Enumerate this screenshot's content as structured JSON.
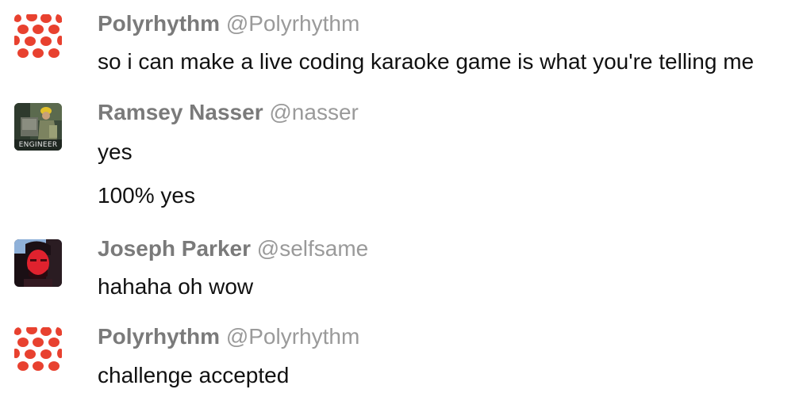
{
  "messages": [
    {
      "display_name": "Polyrhythm",
      "handle": "@Polyrhythm",
      "avatar": "red-polka-dot-avatar",
      "lines": [
        "so i can make a live coding karaoke game is what you're telling me"
      ]
    },
    {
      "display_name": "Ramsey Nasser",
      "handle": "@nasser",
      "avatar": "engineer-photo-avatar",
      "avatar_caption": "ENGINEER",
      "lines": [
        "yes",
        "100% yes"
      ]
    },
    {
      "display_name": "Joseph Parker",
      "handle": "@selfsame",
      "avatar": "red-tinted-portrait-avatar",
      "lines": [
        "hahaha oh wow"
      ]
    },
    {
      "display_name": "Polyrhythm",
      "handle": "@Polyrhythm",
      "avatar": "red-polka-dot-avatar",
      "lines": [
        "challenge accepted"
      ]
    }
  ],
  "colors": {
    "name": "#7a7a7a",
    "handle": "#9a9a9a",
    "text": "#111111",
    "dot_red": "#e8412f"
  }
}
